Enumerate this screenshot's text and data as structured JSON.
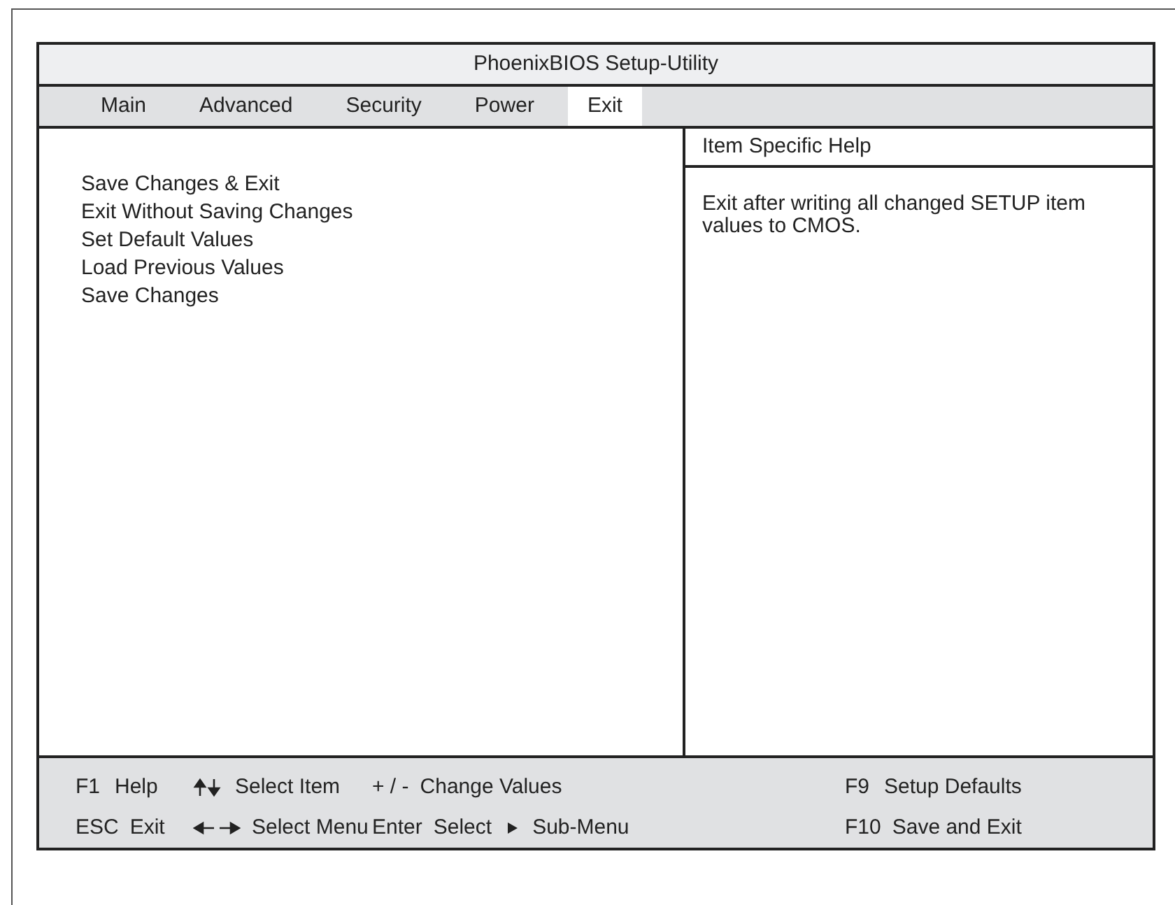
{
  "window": {
    "title": "PhoenixBIOS Setup-Utility"
  },
  "tabs": [
    {
      "label": "Main",
      "selected": false
    },
    {
      "label": "Advanced",
      "selected": false
    },
    {
      "label": "Security",
      "selected": false
    },
    {
      "label": "Power",
      "selected": false
    },
    {
      "label": "Exit",
      "selected": true
    }
  ],
  "menu": {
    "items": [
      "Save Changes & Exit",
      "Exit Without Saving Changes",
      "Set Default Values",
      "Load Previous Values",
      "Save Changes"
    ]
  },
  "help": {
    "title": "Item Specific Help",
    "text": "Exit after writing all changed SETUP item values to CMOS."
  },
  "footer": {
    "rows": [
      [
        {
          "parts": [
            {
              "kind": "key",
              "text": "F1"
            },
            {
              "kind": "label",
              "text": "Help"
            }
          ]
        },
        {
          "parts": [
            {
              "kind": "updown"
            },
            {
              "kind": "label",
              "text": "Select Item"
            }
          ]
        },
        {
          "parts": [
            {
              "kind": "key",
              "text": "+ / -"
            },
            {
              "kind": "label",
              "text": "Change Values"
            }
          ]
        },
        {
          "parts": [
            {
              "kind": "key",
              "text": "F9"
            },
            {
              "kind": "label",
              "text": "Setup Defaults"
            }
          ]
        }
      ],
      [
        {
          "parts": [
            {
              "kind": "key",
              "text": "ESC"
            },
            {
              "kind": "label",
              "text": "Exit"
            }
          ]
        },
        {
          "parts": [
            {
              "kind": "leftright"
            },
            {
              "kind": "label",
              "text": "Select Menu"
            }
          ]
        },
        {
          "parts": [
            {
              "kind": "key",
              "text": "Enter"
            },
            {
              "kind": "label",
              "text": "Select"
            },
            {
              "kind": "triangle"
            },
            {
              "kind": "label",
              "text": "Sub-Menu"
            }
          ]
        },
        {
          "parts": [
            {
              "kind": "key",
              "text": "F10"
            },
            {
              "kind": "label",
              "text": "Save and Exit"
            }
          ]
        }
      ]
    ]
  }
}
